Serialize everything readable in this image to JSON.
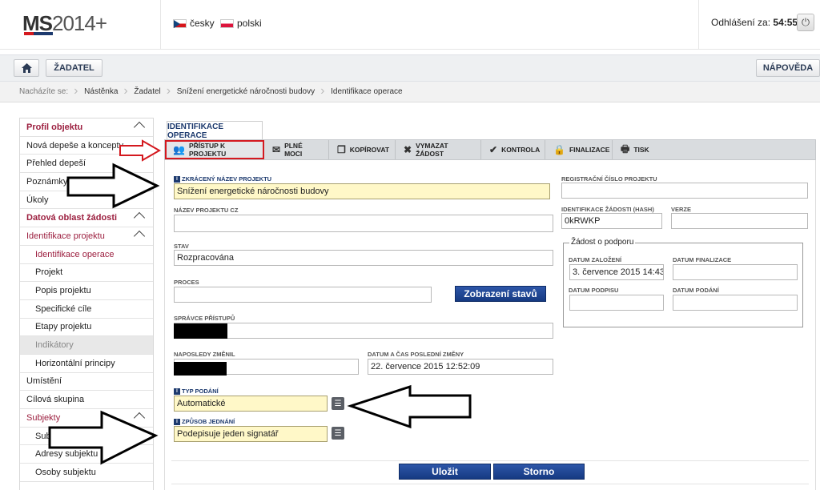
{
  "header": {
    "logo_bold": "MS",
    "logo_light": "2014+",
    "languages": [
      {
        "label": "česky",
        "flag": "cz-flag-icon"
      },
      {
        "label": "polski",
        "flag": "pl-flag-icon"
      }
    ],
    "logout_label": "Odhlášení za:",
    "logout_time": "54:55"
  },
  "navbar": {
    "home_icon": "home-icon",
    "applicant_label": "ŽADATEL",
    "help_label": "NÁPOVĚDA"
  },
  "breadcrumb": {
    "prefix": "Nacházíte se:",
    "items": [
      "Nástěnka",
      "Žadatel",
      "Snížení energetické náročnosti budovy",
      "Identifikace operace"
    ]
  },
  "sidebar": {
    "items": [
      {
        "label": "Profil objektu",
        "kind": "head"
      },
      {
        "label": "Nová depeše a koncepty",
        "kind": "item"
      },
      {
        "label": "Přehled depeší",
        "kind": "item"
      },
      {
        "label": "Poznámky",
        "kind": "item"
      },
      {
        "label": "Úkoly",
        "kind": "item"
      },
      {
        "label": "Datová oblast žádosti",
        "kind": "head"
      },
      {
        "label": "Identifikace projektu",
        "kind": "section"
      },
      {
        "label": "Identifikace operace",
        "kind": "active"
      },
      {
        "label": "Projekt",
        "kind": "sub"
      },
      {
        "label": "Popis projektu",
        "kind": "sub"
      },
      {
        "label": "Specifické cíle",
        "kind": "sub"
      },
      {
        "label": "Etapy projektu",
        "kind": "sub"
      },
      {
        "label": "Indikátory",
        "kind": "disabled"
      },
      {
        "label": "Horizontální principy",
        "kind": "sub"
      },
      {
        "label": "Umístění",
        "kind": "item"
      },
      {
        "label": "Cílová skupina",
        "kind": "item"
      },
      {
        "label": "Subjekty",
        "kind": "section"
      },
      {
        "label": "Subjekty projektu",
        "kind": "sub"
      },
      {
        "label": "Adresy subjektu",
        "kind": "sub"
      },
      {
        "label": "Osoby subjektu",
        "kind": "sub"
      }
    ]
  },
  "main": {
    "tab_title": "IDENTIFIKACE OPERACE",
    "toolbar": [
      {
        "label": "PŘÍSTUP K PROJEKTU",
        "icon": "people-icon"
      },
      {
        "label": "PLNÉ MOCI",
        "icon": "envelope-icon"
      },
      {
        "label": "KOPÍROVAT",
        "icon": "copy-icon"
      },
      {
        "label": "VYMAZAT ŽÁDOST",
        "icon": "delete-icon"
      },
      {
        "label": "KONTROLA",
        "icon": "check-icon"
      },
      {
        "label": "FINALIZACE",
        "icon": "lock-icon"
      },
      {
        "label": "TISK",
        "icon": "printer-icon"
      }
    ],
    "form": {
      "short_name_label": "ZKRÁCENÝ NÁZEV PROJEKTU",
      "short_name_value": "Snížení energetické náročnosti budovy",
      "name_cz_label": "NÁZEV PROJEKTU CZ",
      "name_cz_value": "",
      "status_label": "STAV",
      "status_value": "Rozpracována",
      "process_label": "PROCES",
      "process_value": "",
      "show_states_button": "Zobrazení stavů",
      "access_admin_label": "SPRÁVCE PŘÍSTUPŮ",
      "last_changed_by_label": "NAPOSLEDY ZMĚNIL",
      "last_change_date_label": "DATUM A ČAS POSLEDNÍ ZMĚNY",
      "last_change_date_value": "22. července 2015 12:52:09",
      "submission_type_label": "TYP PODÁNÍ",
      "submission_type_value": "Automatické",
      "signing_mode_label": "ZPŮSOB JEDNÁNÍ",
      "signing_mode_value": "Podepisuje jeden signatář",
      "reg_number_label": "REGISTRAČNÍ ČÍSLO PROJEKTU",
      "reg_number_value": "",
      "hash_label": "IDENTIFIKACE ŽÁDOSTI (HASH)",
      "hash_value": "0kRWKP",
      "version_label": "VERZE",
      "version_value": "",
      "request_fieldset_legend": "Žádost o podporu",
      "created_date_label": "DATUM ZALOŽENÍ",
      "created_date_value": "3. července 2015 14:43:37",
      "final_date_label": "DATUM FINALIZACE",
      "final_date_value": "",
      "sign_date_label": "DATUM PODPISU",
      "sign_date_value": "",
      "submit_date_label": "DATUM PODÁNÍ",
      "submit_date_value": ""
    },
    "save_button": "Uložit",
    "cancel_button": "Storno"
  },
  "colors": {
    "accent_red": "#9c1f3f",
    "highlight_red": "#d4191f",
    "primary_blue": "#1d3a6e",
    "required_yellow": "#fff8c8"
  }
}
